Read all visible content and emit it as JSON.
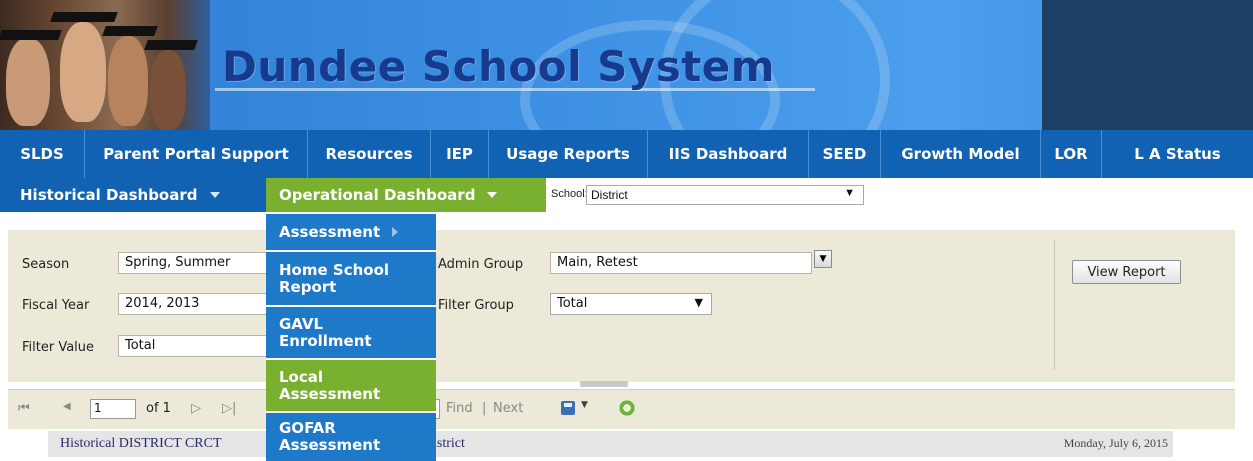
{
  "header": {
    "title": "Dundee School System",
    "colors": {
      "banner": "#3b8ee2",
      "nav": "#1262b3",
      "accent_green": "#7ab030"
    }
  },
  "main_nav": {
    "items": [
      {
        "label": "SLDS"
      },
      {
        "label": "Parent Portal Support"
      },
      {
        "label": "Resources"
      },
      {
        "label": "IEP"
      },
      {
        "label": "Usage Reports"
      },
      {
        "label": "IIS Dashboard"
      },
      {
        "label": "SEED"
      },
      {
        "label": "Growth Model"
      },
      {
        "label": "LOR"
      },
      {
        "label": "L A Status"
      }
    ]
  },
  "sub_nav": {
    "historical": "Historical Dashboard",
    "operational": "Operational Dashboard",
    "school_label": "School:",
    "school_value": "District"
  },
  "operational_menu": {
    "items": [
      {
        "label": "Assessment",
        "has_submenu": true
      },
      {
        "label": "Home School Report"
      },
      {
        "label": "GAVL Enrollment"
      },
      {
        "label": "Local Assessment",
        "highlighted": true
      },
      {
        "label": "GOFAR Assessment"
      }
    ]
  },
  "params": {
    "season_label": "Season",
    "season_value": "Spring, Summer",
    "fiscal_year_label": "Fiscal Year",
    "fiscal_year_value": "2014, 2013",
    "filter_value_label": "Filter Value",
    "filter_value_value": "Total",
    "admin_group_label": "Admin Group",
    "admin_group_value": "Main, Retest",
    "filter_group_label": "Filter Group",
    "filter_group_value": "Total",
    "view_report": "View Report"
  },
  "toolbar": {
    "first": "⏮",
    "prev": "◀",
    "page": "1",
    "of_pages": "of 1",
    "next": "▷",
    "last": "▷|",
    "find": "Find",
    "separator": "|",
    "next_find": "Next",
    "save_icon": "save-icon",
    "refresh_icon": "refresh-icon"
  },
  "report": {
    "title": "Historical  DISTRICT CRCT",
    "scope": "istrict",
    "date": "Monday, July 6, 2015"
  }
}
